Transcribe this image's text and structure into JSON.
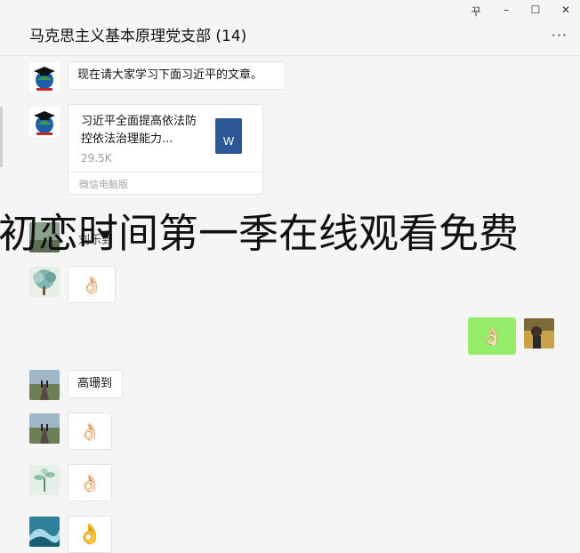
{
  "window": {
    "title": "马克思主义基本原理党支部 (14)",
    "controls": {
      "pin": "꾸",
      "minimize": "–",
      "maximize": "☐",
      "close": "✕"
    },
    "more": "···"
  },
  "messages": {
    "m1": {
      "text": "现在请大家学习下面习近平的文章。"
    },
    "file": {
      "name": "习近平全面提高依法防控依法治理能力...",
      "size": "29.5K",
      "source": "微信电脑版",
      "icon_letter": "W"
    },
    "overlay_text": "初恋时间第一季在线观看免费",
    "name_label": "刘乐到",
    "ok_emoji": "👌🏻",
    "ok_emoji_large": "👌",
    "m_gaoshan": {
      "text": "高珊到"
    }
  },
  "colors": {
    "self_bubble": "#95ec69",
    "background": "#f5f5f5",
    "word_icon": "#2b5797"
  }
}
